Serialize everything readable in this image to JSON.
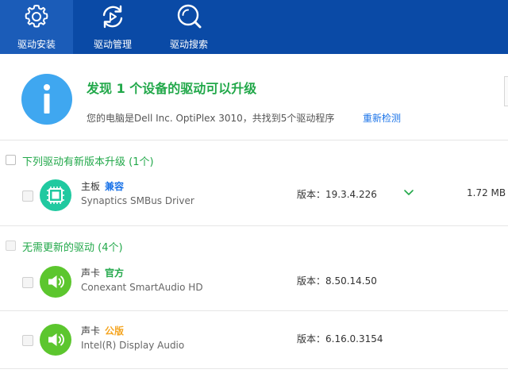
{
  "nav": {
    "tabs": [
      {
        "label": "驱动安装",
        "icon": "gear-icon",
        "active": true
      },
      {
        "label": "驱动管理",
        "icon": "refresh-icon",
        "active": false
      },
      {
        "label": "驱动搜索",
        "icon": "search-icon",
        "active": false
      }
    ]
  },
  "summary": {
    "icon": "info-icon",
    "headline": "发现 1 个设备的驱动可以升级",
    "subtitle": "您的电脑是Dell Inc. OptiPlex 3010，共找到5个驱动程序",
    "recheck_label": "重新检测"
  },
  "sections": [
    {
      "title": "下列驱动有新版本升级 (1个)",
      "rows": [
        {
          "category": "主板",
          "tag": "兼容",
          "tag_color": "#1a73e8",
          "name": "Synaptics SMBus Driver",
          "version": "版本：19.3.4.226",
          "size": "1.72 MB",
          "icon": "motherboard-icon",
          "icon_color": "#20c9a0"
        }
      ]
    },
    {
      "title": "无需更新的驱动 (4个)",
      "rows": [
        {
          "category": "声卡",
          "tag": "官方",
          "tag_color": "#22a84a",
          "name": "Conexant SmartAudio HD",
          "version": "版本：8.50.14.50",
          "icon": "speaker-icon",
          "icon_color": "#5cc62e"
        },
        {
          "category": "声卡",
          "tag": "公版",
          "tag_color": "#f5a623",
          "name": "Intel(R) Display Audio",
          "version": "版本：6.16.0.3154",
          "icon": "speaker-icon",
          "icon_color": "#5cc62e"
        }
      ]
    }
  ],
  "colors": {
    "topbar": "#0a4aa6",
    "accent_green": "#22a84a",
    "link_blue": "#1a73e8",
    "info_blue": "#3fa7f0"
  }
}
